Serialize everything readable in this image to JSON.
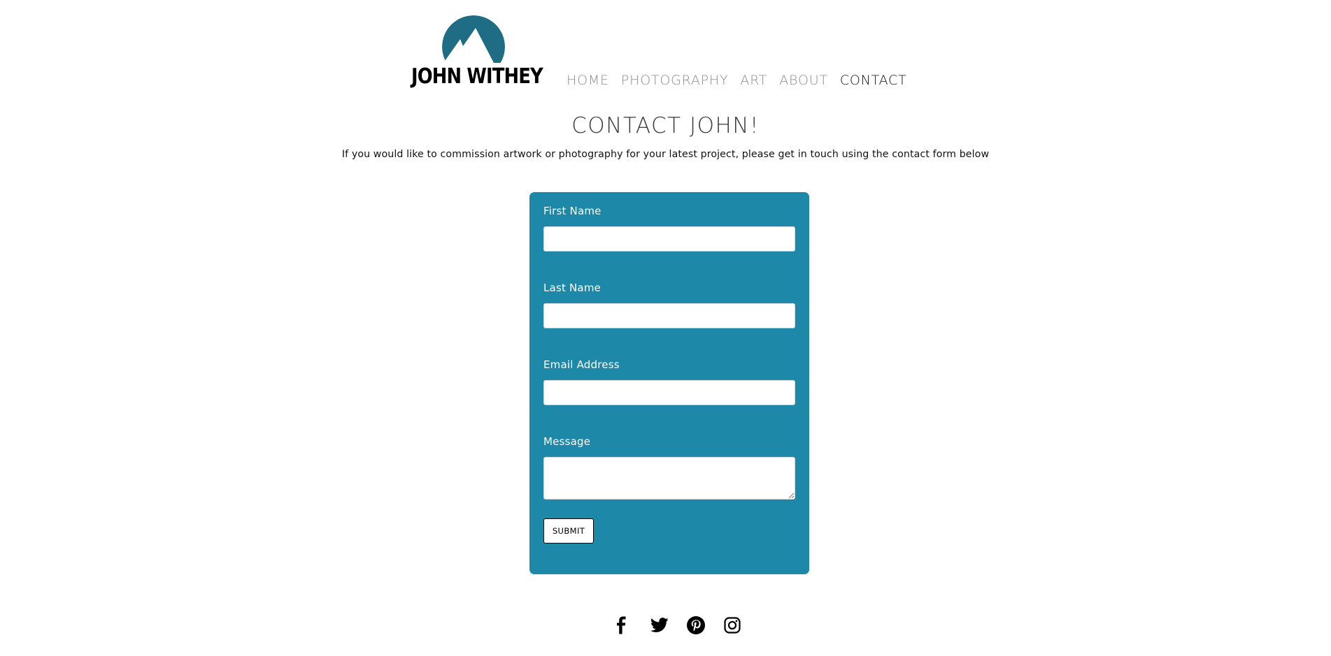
{
  "brand": {
    "name": "JOHN WITHEY",
    "logo_icon": "mountain-logo-icon",
    "logo_color": "#1e6d85"
  },
  "nav": {
    "items": [
      {
        "label": "HOME",
        "active": false
      },
      {
        "label": "PHOTOGRAPHY",
        "active": false
      },
      {
        "label": "ART",
        "active": false
      },
      {
        "label": "ABOUT",
        "active": false
      },
      {
        "label": "CONTACT",
        "active": true
      }
    ]
  },
  "page": {
    "title": "CONTACT JOHN!",
    "subtitle": "If you would like to commission artwork or photography for your latest project, please get in touch using the contact form below"
  },
  "form": {
    "background_color": "#1e88a8",
    "fields": [
      {
        "label": "First Name",
        "value": "",
        "placeholder": ""
      },
      {
        "label": "Last Name",
        "value": "",
        "placeholder": ""
      },
      {
        "label": "Email Address",
        "value": "",
        "placeholder": ""
      },
      {
        "label": "Message",
        "value": "",
        "placeholder": ""
      }
    ],
    "submit_label": "SUBMIT"
  },
  "social": {
    "icons": [
      "facebook-icon",
      "twitter-icon",
      "pinterest-icon",
      "instagram-icon"
    ]
  }
}
